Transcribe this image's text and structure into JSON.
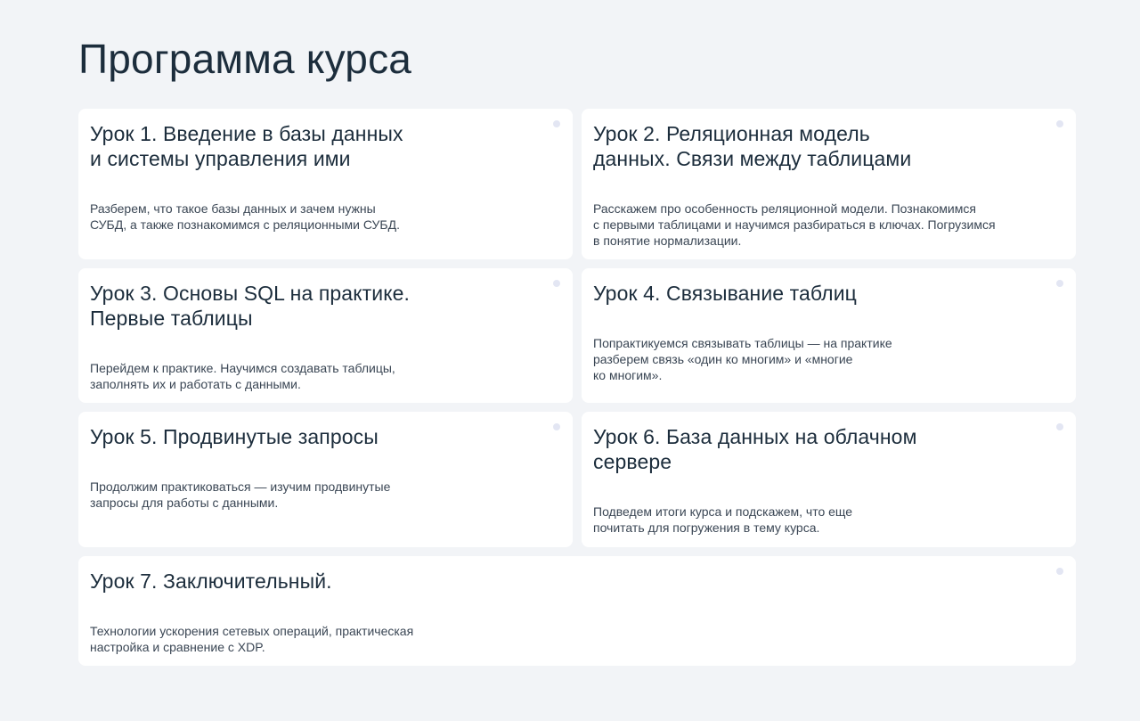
{
  "page": {
    "title": "Программа курса"
  },
  "lessons": [
    {
      "title": "Урок 1. Введение в базы данных\nи системы управления ими",
      "description": "Разберем, что такое базы данных и зачем нужны\nСУБД, а также познакомимся с реляционными СУБД."
    },
    {
      "title": "Урок 2. Реляционная модель\nданных. Связи между таблицами",
      "description": "Расскажем про особенность реляционной модели. Познакомимся\nс первыми таблицами и научимся разбираться в ключах. Погрузимся\nв понятие нормализации."
    },
    {
      "title": "Урок 3. Основы SQL на практике.\nПервые таблицы",
      "description": "Перейдем к практике. Научимся создавать таблицы,\nзаполнять их и работать с данными."
    },
    {
      "title": "Урок 4. Связывание таблиц",
      "description": "Попрактикуемся связывать таблицы — на практике\nразберем связь «один ко многим» и «многие\nко многим»."
    },
    {
      "title": "Урок 5. Продвинутые запросы",
      "description": "Продолжим практиковаться — изучим продвинутые\nзапросы для работы с данными."
    },
    {
      "title": "Урок 6. База данных на облачном\nсервере",
      "description": "Подведем итоги курса и подскажем, что еще\nпочитать для погружения в тему курса."
    },
    {
      "title": "Урок 7. Заключительный.",
      "description": "Технологии ускорения сетевых операций, практическая\nнастройка и сравнение с XDP."
    }
  ],
  "colors": {
    "background": "#f2f4f7",
    "card": "#ffffff",
    "text": "#1c2d3c",
    "dot": "#e3e6f3"
  }
}
